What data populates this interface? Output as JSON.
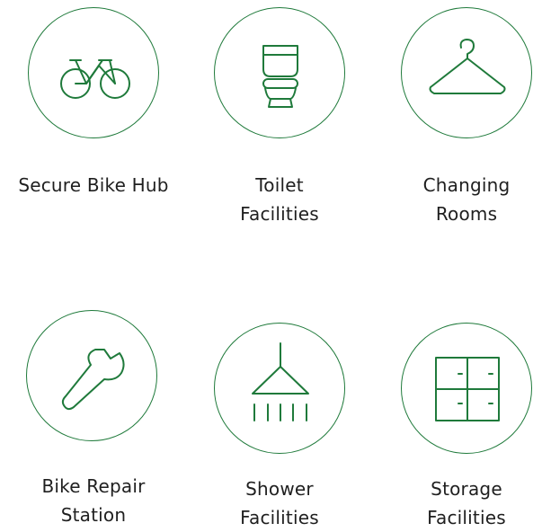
{
  "theme": {
    "accent_color": "#1f7a3b",
    "text_color": "#1f1f1f",
    "background_color": "#ffffff"
  },
  "amenities": [
    {
      "icon": "bicycle-icon",
      "label_lines": [
        "Secure Bike Hub"
      ]
    },
    {
      "icon": "toilet-icon",
      "label_lines": [
        "Toilet",
        "Facilities"
      ]
    },
    {
      "icon": "clothes-hanger-icon",
      "label_lines": [
        "Changing",
        "Rooms"
      ]
    },
    {
      "icon": "wrench-icon",
      "label_lines": [
        "Bike Repair",
        "Station"
      ]
    },
    {
      "icon": "shower-icon",
      "label_lines": [
        "Shower",
        "Facilities"
      ]
    },
    {
      "icon": "storage-locker-icon",
      "label_lines": [
        "Storage",
        "Facilities"
      ]
    }
  ]
}
